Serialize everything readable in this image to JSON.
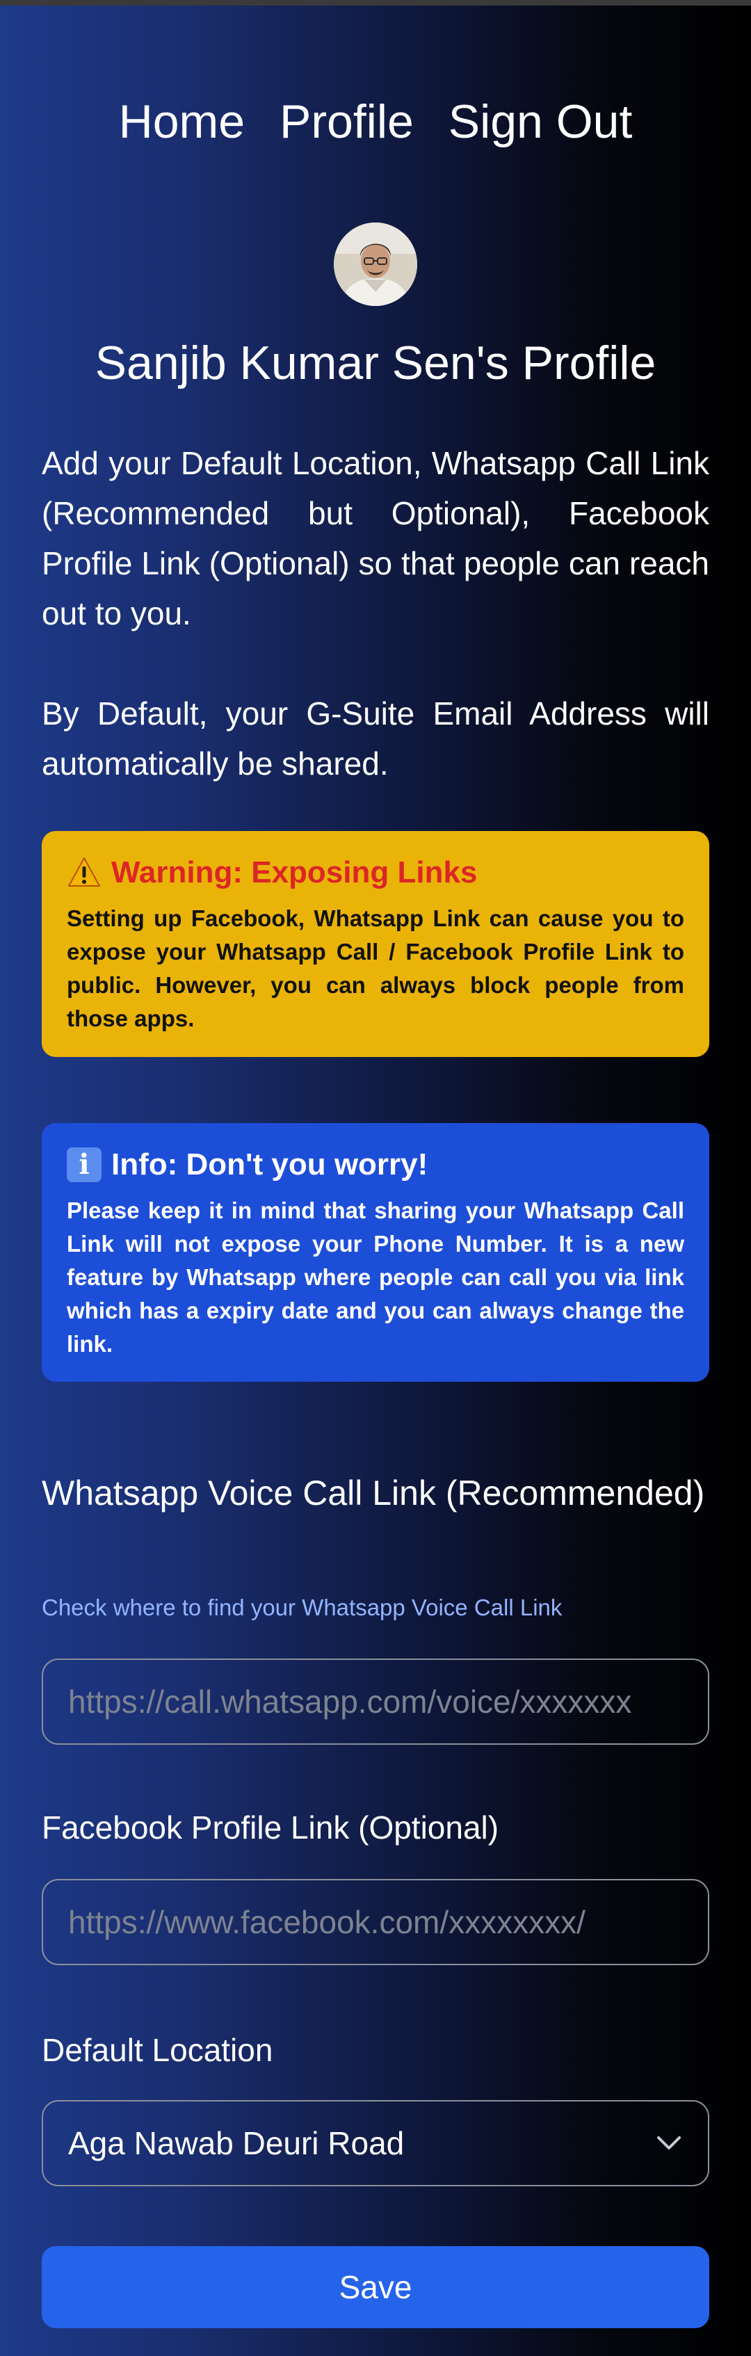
{
  "nav": {
    "items": [
      {
        "label": "Home"
      },
      {
        "label": "Profile"
      },
      {
        "label": "Sign Out"
      }
    ]
  },
  "profile": {
    "title": "Sanjib Kumar Sen's Profile",
    "description": "Add your Default Location, Whatsapp Call Link (Recommended but Optional), Facebook Profile Link (Optional) so that people can reach out to you.",
    "email_note": "By Default, your G-Suite Email Address will automatically be shared."
  },
  "warning": {
    "icon": "warning-icon",
    "title": "Warning: Exposing Links",
    "body": "Setting up Facebook, Whatsapp Link can cause you to expose your Whatsapp Call / Facebook Profile Link to public. However, you can always block people from those apps.",
    "background": "#eab308",
    "title_color": "#dc2626"
  },
  "info": {
    "icon": "info-icon",
    "title": "Info: Don't you worry!",
    "body": "Please keep it in mind that sharing your Whatsapp Call Link will not expose your Phone Number. It is a new feature by Whatsapp where people can call you via link which has a expiry date and you can always change the link.",
    "background": "#1d4ed8"
  },
  "form": {
    "whatsapp": {
      "label": "Whatsapp Voice Call Link (Recommended)",
      "help_link": "Check where to find your Whatsapp Voice Call Link",
      "placeholder": "https://call.whatsapp.com/voice/xxxxxxx",
      "value": ""
    },
    "facebook": {
      "label": "Facebook Profile Link (Optional)",
      "placeholder": "https://www.facebook.com/xxxxxxxx/",
      "value": ""
    },
    "location": {
      "label": "Default Location",
      "selected": "Aga Nawab Deuri Road"
    },
    "save_label": "Save"
  },
  "colors": {
    "accent": "#2563eb",
    "link": "#93b4ff"
  }
}
